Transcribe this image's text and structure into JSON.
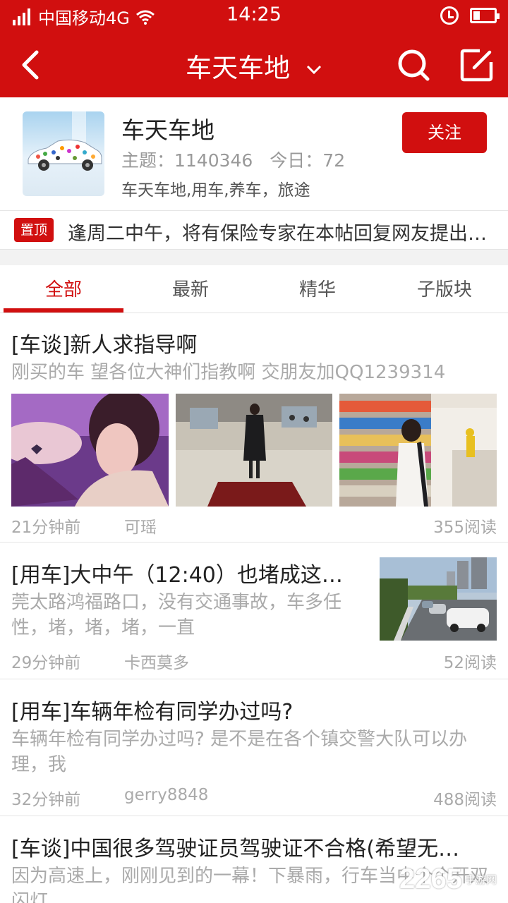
{
  "status_bar": {
    "carrier": "中国移动4G",
    "time": "14:25"
  },
  "nav": {
    "title": "车天车地"
  },
  "forum": {
    "name": "车天车地",
    "topics": "主题：1140346",
    "today": "今日：72",
    "tags": "车天车地,用车,养车，旅途",
    "follow_label": "关注"
  },
  "pinned": {
    "badge": "置顶",
    "text": "逢周二中午，将有保险专家在本帖回复网友提出…"
  },
  "tabs": [
    {
      "label": "全部",
      "active": true
    },
    {
      "label": "最新",
      "active": false
    },
    {
      "label": "精华",
      "active": false
    },
    {
      "label": "子版块",
      "active": false
    }
  ],
  "posts": [
    {
      "title": "[车谈]新人求指导啊",
      "summary": "刚买的车 望各位大神们指教啊 交朋友加QQ1239314",
      "time": "21分钟前",
      "author": "可瑶",
      "reads": "355阅读"
    },
    {
      "title": "[用车]大中午（12:40）也堵成这…",
      "summary": "莞太路鸿福路口，没有交通事故，车多任性，堵，堵，堵，一直",
      "time": "29分钟前",
      "author": "卡西莫多",
      "reads": "52阅读"
    },
    {
      "title": "[用车]车辆年检有同学办过吗?",
      "summary": "车辆年检有同学办过吗? 是不是在各个镇交警大队可以办理，我",
      "time": "32分钟前",
      "author": "gerry8848",
      "reads": "488阅读"
    },
    {
      "title": "[车谈]中国很多驾驶证员驾驶证不合格(希望无…",
      "summary": "因为高速上，刚刚见到的一幕！下暴雨，行车当中个个开双闪灯"
    }
  ],
  "watermark": {
    "number": "2265",
    "site": "手游网"
  },
  "colors": {
    "brand_red": "#d10f0f",
    "text_primary": "#222222",
    "text_muted": "#aaaaaa"
  }
}
